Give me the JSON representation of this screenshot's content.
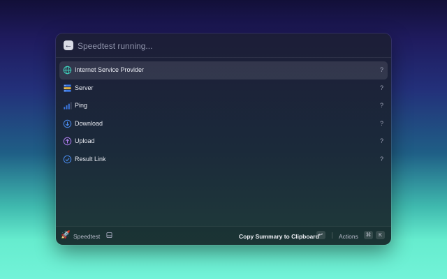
{
  "search": {
    "back_icon": "arrow-left-icon",
    "placeholder": "Speedtest running..."
  },
  "list": {
    "items": [
      {
        "label": "Internet Service Provider",
        "accessory": "?",
        "icon": "globe-icon"
      },
      {
        "label": "Server",
        "accessory": "?",
        "icon": "server-icon"
      },
      {
        "label": "Ping",
        "accessory": "?",
        "icon": "signal-bars-icon"
      },
      {
        "label": "Download",
        "accessory": "?",
        "icon": "download-icon"
      },
      {
        "label": "Upload",
        "accessory": "?",
        "icon": "upload-icon"
      },
      {
        "label": "Result Link",
        "accessory": "?",
        "icon": "check-circle-icon"
      }
    ]
  },
  "footer": {
    "extension_name": "Speedtest",
    "primary_action": "Copy Summary to Clipboard",
    "enter_key": "↵",
    "actions_label": "Actions",
    "cmd_key": "⌘",
    "k_key": "K"
  },
  "colors": {
    "accent": "#3d7be8",
    "background_top": "#1f1b5e",
    "background_bottom": "#72f3d8"
  }
}
